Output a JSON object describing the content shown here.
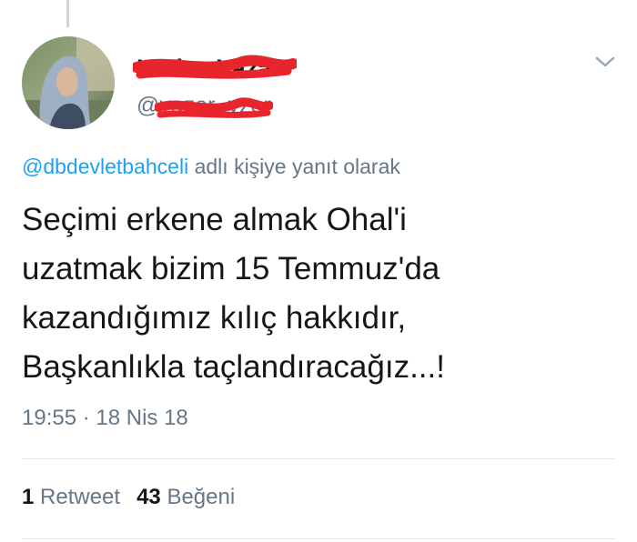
{
  "user": {
    "display_name": "Hatice Yazar",
    "handle": "@yazar_yzer",
    "avatar_icon": "person-headscarf-avatar"
  },
  "reply": {
    "mention": "@dbdevletbahceli",
    "suffix": " adlı kişiye yanıt olarak"
  },
  "tweet": {
    "lines": [
      "Seçimi erkene almak Ohal'i",
      "uzatmak bizim 15 Temmuz'da",
      "kazandığımız kılıç hakkıdır,",
      "Başkanlıkla taçlandıracağız...!"
    ],
    "time": "19:55",
    "separator": " · ",
    "date": "18 Nis 18"
  },
  "stats": {
    "retweet_count": "1",
    "retweet_label": "Retweet",
    "like_count": "43",
    "like_label": "Beğeni"
  },
  "icons": {
    "menu": "chevron-down-icon"
  },
  "colors": {
    "link": "#1da1f2",
    "secondary_text": "#657786",
    "redaction": "#e8242c"
  }
}
